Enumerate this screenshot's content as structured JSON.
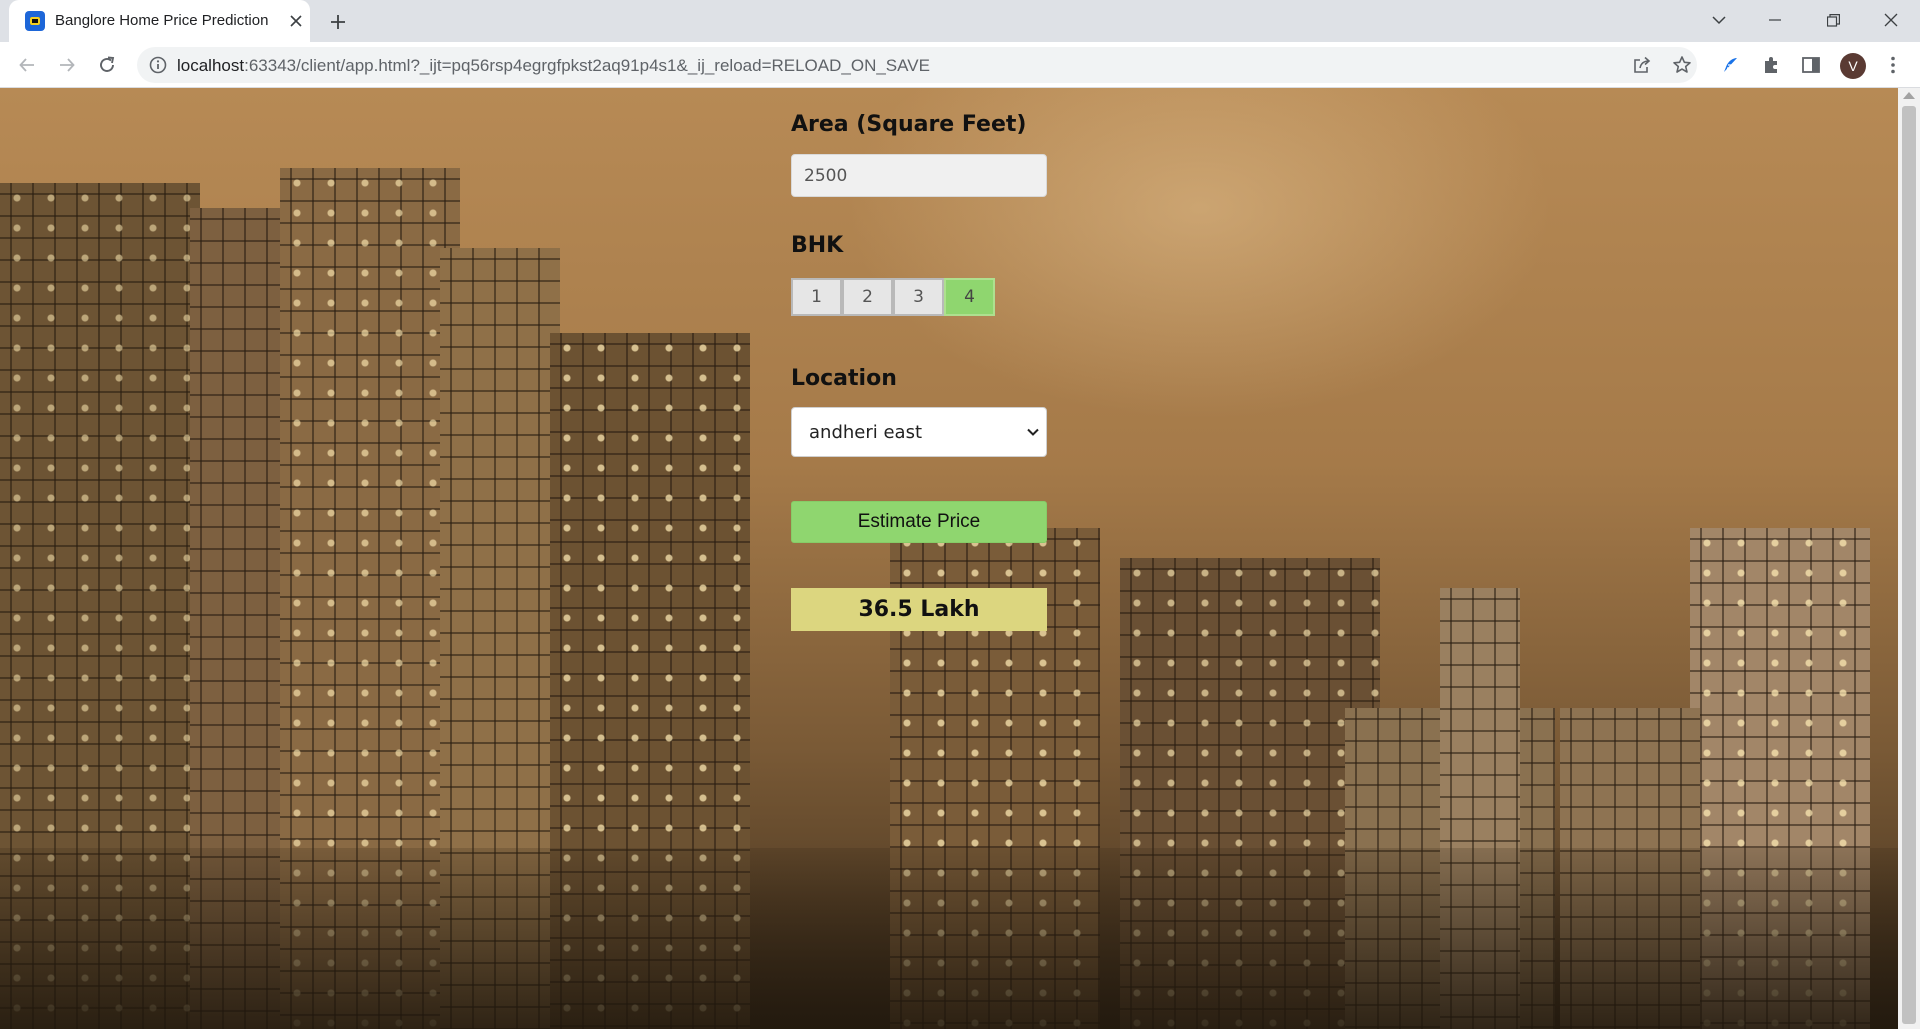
{
  "browser": {
    "tab": {
      "title": "Banglore Home Price Prediction",
      "favicon": "pycharm-icon"
    },
    "url": {
      "host": "localhost",
      "rest": ":63343/client/app.html?_ijt=pq56rsp4egrgfpkst2aq91p4s1&_ij_reload=RELOAD_ON_SAVE"
    },
    "profile_initial": "V"
  },
  "form": {
    "area_label": "Area (Square Feet)",
    "area_value": "2500",
    "bhk_label": "BHK",
    "bhk_options": [
      "1",
      "2",
      "3",
      "4"
    ],
    "bhk_selected": "4",
    "location_label": "Location",
    "location_value": "andheri east",
    "estimate_label": "Estimate Price",
    "result": "36.5 Lakh"
  },
  "colors": {
    "accent_green": "#8fd66f",
    "result_bg": "#dcd67f"
  }
}
